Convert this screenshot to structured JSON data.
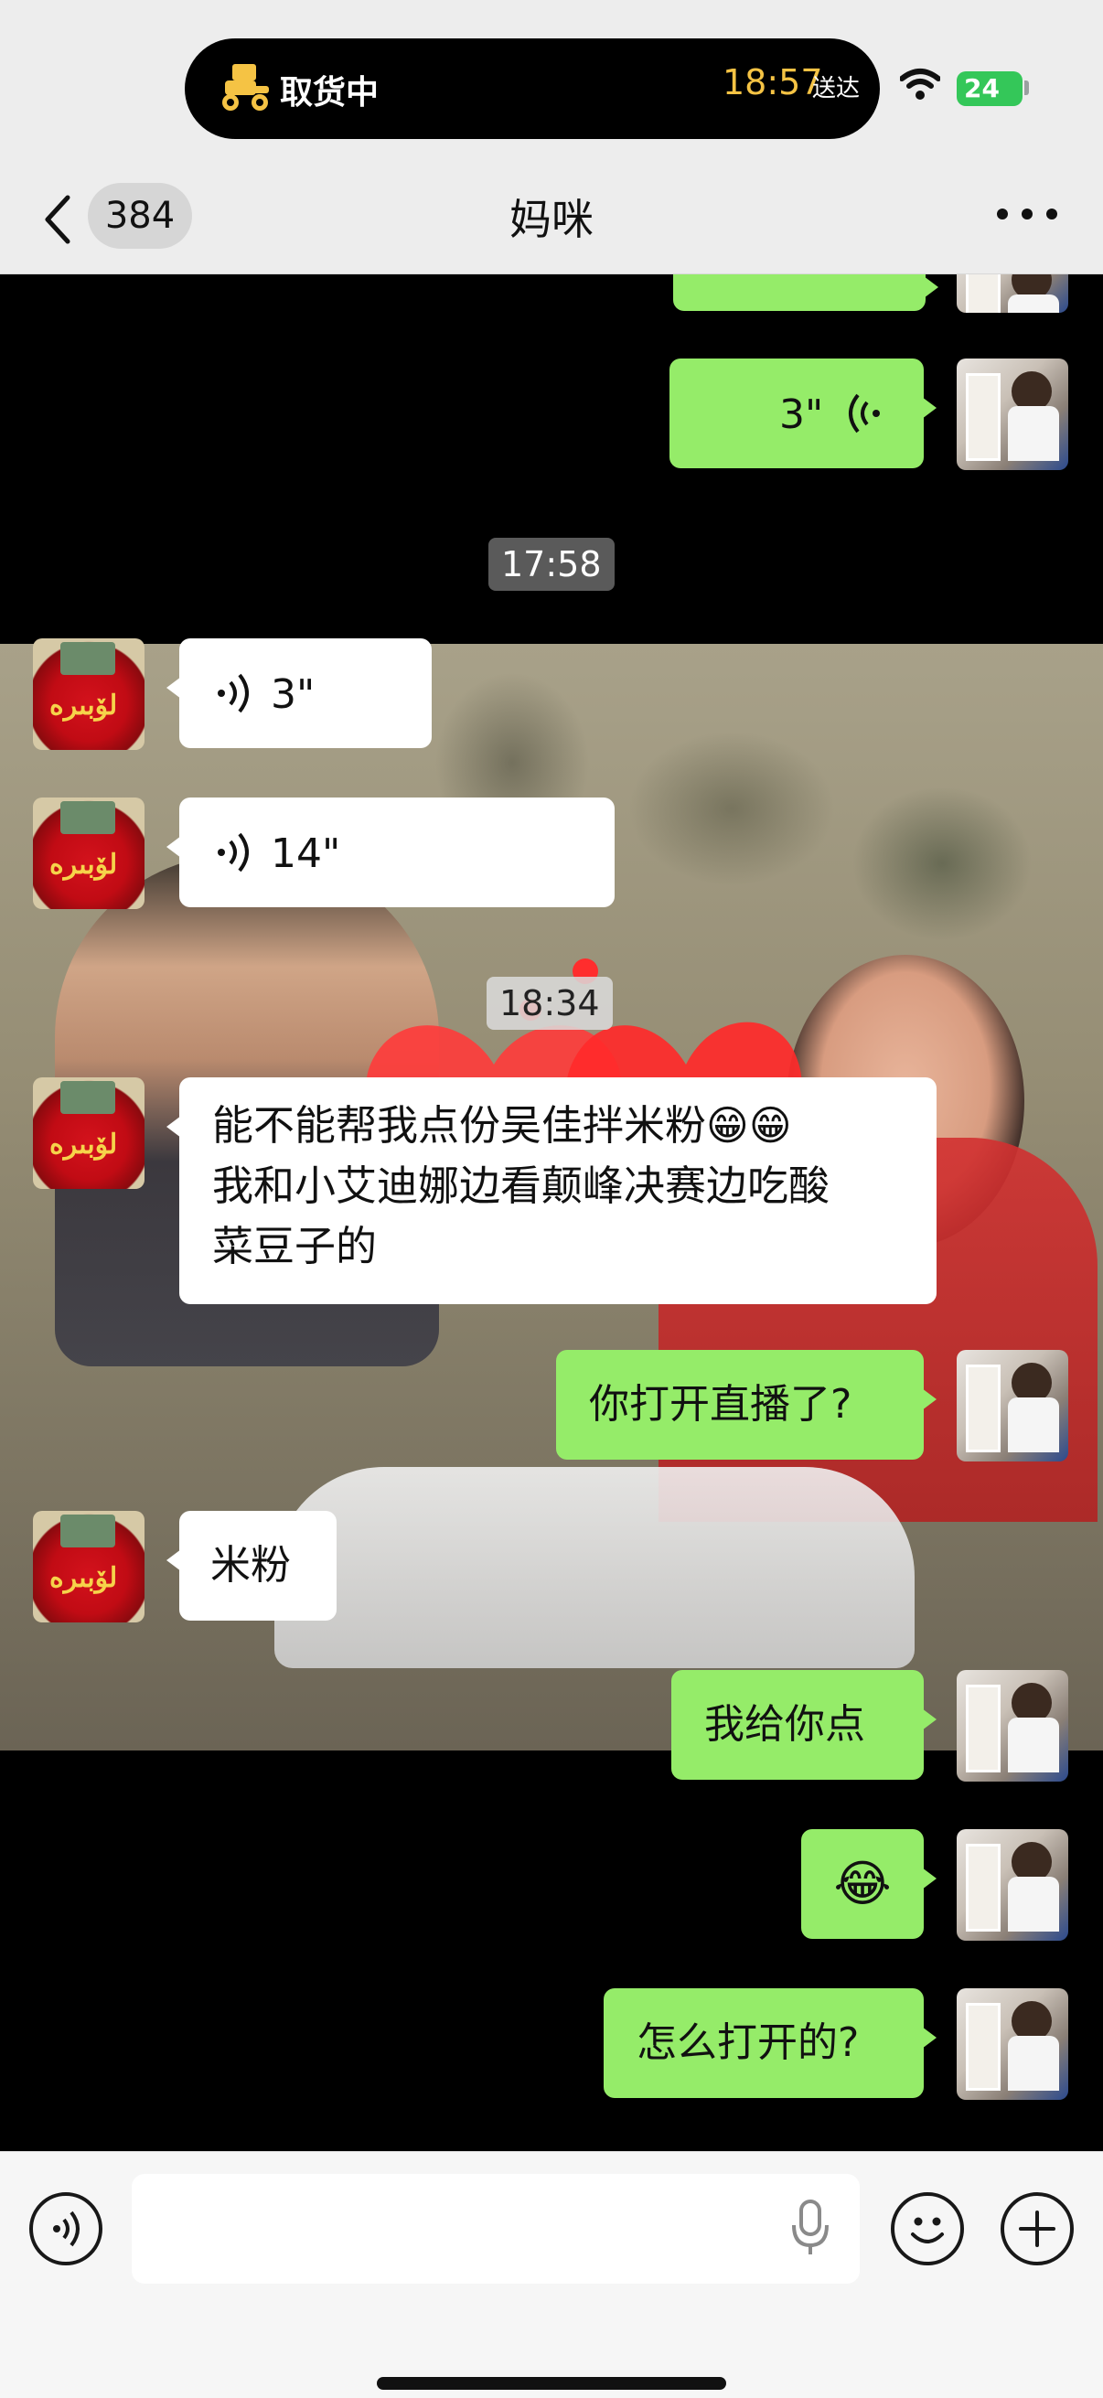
{
  "status_bar": {
    "delivery_label": "取货中",
    "eta_time": "18:57",
    "eta_suffix": "送达",
    "battery": "24"
  },
  "nav": {
    "unread_count": "384",
    "title": "妈咪"
  },
  "messages": [
    {
      "from": "me",
      "type": "voice",
      "duration": "3\""
    },
    {
      "type": "timestamp",
      "text": "17:58"
    },
    {
      "from": "mom",
      "type": "voice",
      "duration": "3\""
    },
    {
      "from": "mom",
      "type": "voice",
      "duration": "14\""
    },
    {
      "type": "timestamp",
      "text": "18:34"
    },
    {
      "from": "mom",
      "type": "text",
      "lines": [
        "能不能帮我点份吴佳拌米粉😁😁",
        "我和小艾迪娜边看颠峰决赛边吃酸",
        "菜豆子的"
      ]
    },
    {
      "from": "me",
      "type": "text",
      "text": "你打开直播了?"
    },
    {
      "from": "mom",
      "type": "text",
      "text": "米粉"
    },
    {
      "from": "me",
      "type": "text",
      "text": "我给你点"
    },
    {
      "from": "me",
      "type": "emoji",
      "text": "😂"
    },
    {
      "from": "me",
      "type": "text",
      "text": "怎么打开的?"
    }
  ],
  "colors": {
    "my_bubble": "#95ec69",
    "their_bubble": "#ffffff",
    "bar_background": "#ededed",
    "eta_time": "#f5c344",
    "battery": "#34c759"
  },
  "icons": {
    "back": "chevron-left-icon",
    "more": "more-dots-icon",
    "voice_mode": "voice-icon",
    "emoji": "smiley-icon",
    "add": "plus-icon",
    "mic": "mic-icon",
    "wifi": "wifi-icon"
  }
}
